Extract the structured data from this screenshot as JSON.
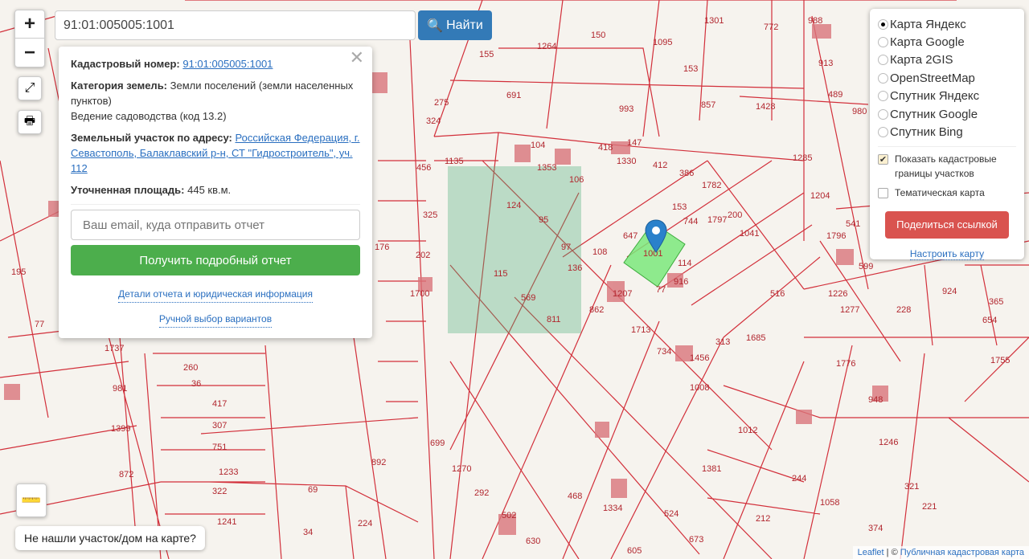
{
  "search": {
    "value": "91:01:005005:1001",
    "button": "Найти"
  },
  "popup": {
    "cad_label": "Кадастровый номер:",
    "cad_value": "91:01:005005:1001",
    "cat_label": "Категория земель:",
    "cat_value": "Земли поселений (земли населенных пунктов)",
    "use": "Ведение садоводства (код 13.2)",
    "addr_label": "Земельный участок по адресу:",
    "addr_value": "Российская Федерация, г. Севастополь, Балаклавский р-н, СТ \"Гидростроитель\", уч. 112",
    "area_label": "Уточненная площадь:",
    "area_value": "445 кв.м.",
    "email_placeholder": "Ваш email, куда отправить отчет",
    "report_button": "Получить подробный отчет",
    "details_link": "Детали отчета и юридическая информация",
    "manual_link": "Ручной выбор вариантов"
  },
  "layers": {
    "options": [
      "Карта Яндекс",
      "Карта Google",
      "Карта 2GIS",
      "OpenStreetMap",
      "Спутник Яндекс",
      "Спутник Google",
      "Спутник Bing"
    ],
    "selected": 0,
    "show_borders": "Показать кадастровые границы участков",
    "thematic": "Тематическая карта",
    "share": "Поделиться ссылкой",
    "configure": "Настроить карту"
  },
  "not_found": "Не нашли участок/дом на карте?",
  "attribution": {
    "leaflet": "Leaflet",
    "sep": " | © ",
    "pkk": "Публичная кадастровая карта"
  },
  "map_labels": [
    "1001",
    "114",
    "916",
    "77",
    "647",
    "108",
    "136",
    "97",
    "95",
    "124",
    "115",
    "569",
    "811",
    "862",
    "1207",
    "1713",
    "734",
    "1456",
    "1008",
    "313",
    "1685",
    "516",
    "1041",
    "200",
    "1797",
    "744",
    "153",
    "1782",
    "386",
    "412",
    "1330",
    "418",
    "147",
    "104",
    "1353",
    "106",
    "993",
    "857",
    "1428",
    "153",
    "150",
    "1095",
    "1301",
    "691",
    "155",
    "1264",
    "275",
    "324",
    "456",
    "1135",
    "325",
    "202",
    "1700",
    "176",
    "195",
    "77",
    "1737",
    "981",
    "872",
    "1399",
    "260",
    "36",
    "417",
    "307",
    "751",
    "1233",
    "322",
    "1241",
    "34",
    "69",
    "224",
    "892",
    "699",
    "1270",
    "292",
    "502",
    "630",
    "468",
    "1334",
    "605",
    "524",
    "673",
    "212",
    "1058",
    "374",
    "244",
    "1381",
    "1012",
    "948",
    "1246",
    "321",
    "221",
    "1776",
    "1755",
    "654",
    "228",
    "1277",
    "924",
    "541",
    "1204",
    "1285",
    "913",
    "489",
    "980",
    "772",
    "988",
    "365",
    "599",
    "1796",
    "1226"
  ],
  "colors": {
    "parcel": "#d22f3a",
    "selected": "#6fe36f",
    "accent": "#337ab7",
    "green": "#4cae4c",
    "red": "#d9534f"
  }
}
